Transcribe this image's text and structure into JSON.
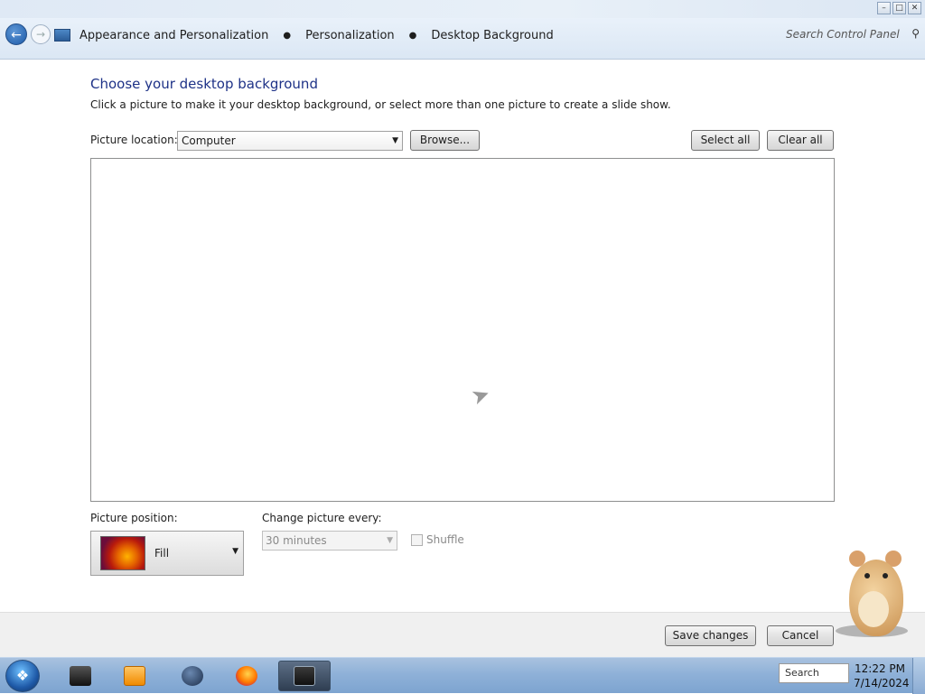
{
  "window": {
    "controls": [
      "minimize",
      "maximize",
      "close"
    ]
  },
  "address_bar": {
    "breadcrumbs": [
      "Appearance and Personalization",
      "Personalization",
      "Desktop Background"
    ],
    "search_placeholder": "Search Control Panel"
  },
  "main": {
    "title": "Choose your desktop background",
    "subtitle": "Click a picture to make it your desktop background, or select more than one picture to create a slide show.",
    "picture_location": {
      "label": "Picture location:",
      "value": "Computer"
    },
    "browse_label": "Browse...",
    "select_all_label": "Select all",
    "clear_all_label": "Clear all",
    "picture_position": {
      "label": "Picture position:",
      "value": "Fill"
    },
    "change_picture": {
      "label": "Change picture every:",
      "value": "30 minutes"
    },
    "shuffle_label": "Shuffle"
  },
  "footer": {
    "save_label": "Save changes",
    "cancel_label": "Cancel"
  },
  "taskbar": {
    "tray_search": "Search",
    "time": "12:22 PM",
    "date": "7/14/2024"
  },
  "colors": {
    "title_blue": "#1e3287",
    "taskbar": "#8fb1d8"
  }
}
